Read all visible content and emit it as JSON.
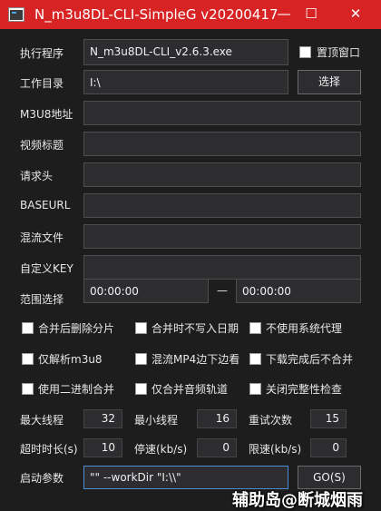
{
  "window": {
    "title": "N_m3u8DL-CLI-SimpleG v20200417",
    "minimize_glyph": "—",
    "maximize_glyph": "☐",
    "close_glyph": "✕",
    "titlebar_color": "#d72323"
  },
  "form": {
    "exe": {
      "label": "执行程序",
      "value": "N_m3u8DL-CLI_v2.6.3.exe"
    },
    "topmost": {
      "label": "置顶窗口",
      "checked": false
    },
    "workdir": {
      "label": "工作目录",
      "value": "I:\\",
      "button": "选择"
    },
    "m3u8": {
      "label": "M3U8地址",
      "value": ""
    },
    "video_title": {
      "label": "视频标题",
      "value": ""
    },
    "headers": {
      "label": "请求头",
      "value": ""
    },
    "baseurl": {
      "label": "BASEURL",
      "value": ""
    },
    "mux_file": {
      "label": "混流文件",
      "value": ""
    },
    "custom_key": {
      "label": "自定义KEY",
      "value": ""
    },
    "range": {
      "label": "范围选择",
      "start": "00:00:00",
      "separator": "—",
      "end": "00:00:00"
    }
  },
  "options": [
    {
      "label": "合并后删除分片",
      "checked": false
    },
    {
      "label": "合并时不写入日期",
      "checked": false
    },
    {
      "label": "不使用系统代理",
      "checked": false
    },
    {
      "label": "仅解析m3u8",
      "checked": false
    },
    {
      "label": "混流MP4边下边看",
      "checked": false
    },
    {
      "label": "下载完成后不合并",
      "checked": false
    },
    {
      "label": "使用二进制合并",
      "checked": false
    },
    {
      "label": "仅合并音频轨道",
      "checked": false
    },
    {
      "label": "关闭完整性检查",
      "checked": false
    }
  ],
  "numbers": [
    {
      "label": "最大线程",
      "value": "32"
    },
    {
      "label": "最小线程",
      "value": "16"
    },
    {
      "label": "重试次数",
      "value": "15"
    },
    {
      "label": "超时时长(s)",
      "value": "10"
    },
    {
      "label": "停速(kb/s)",
      "value": "0"
    },
    {
      "label": "限速(kb/s)",
      "value": "0"
    }
  ],
  "launch": {
    "label": "启动参数",
    "value": "\"\" --workDir \"I:\\\\\"",
    "go_label": "GO(S)"
  },
  "watermark": {
    "text": "辅助岛@断城烟雨"
  }
}
